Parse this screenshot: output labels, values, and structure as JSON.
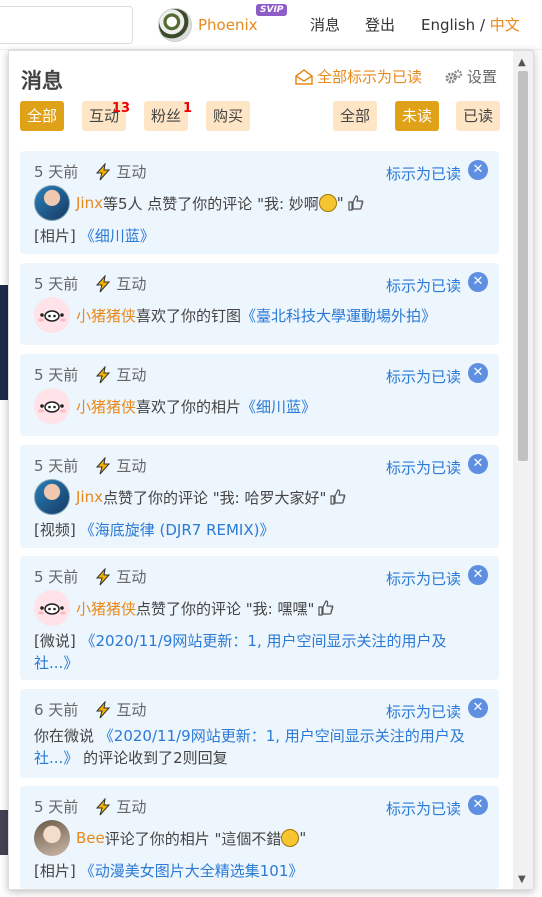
{
  "header": {
    "username": "Phoenix",
    "vip_badge": "SVIP",
    "nav_messages": "消息",
    "nav_login": "登出",
    "lang_en": "English",
    "lang_sep": "/",
    "lang_cn": "中文"
  },
  "popup": {
    "title": "消息",
    "mark_all": "全部标示为已读",
    "settings": "设置",
    "type_tabs": [
      {
        "label": "全部",
        "badge": ""
      },
      {
        "label": "互动",
        "badge": "13"
      },
      {
        "label": "粉丝",
        "badge": "1"
      },
      {
        "label": "购买",
        "badge": ""
      }
    ],
    "read_tabs": [
      {
        "label": "全部"
      },
      {
        "label": "未读"
      },
      {
        "label": "已读"
      }
    ],
    "mark_read_label": "标示为已读",
    "close_glyph": "✕",
    "notifications": [
      {
        "time": "5 天前",
        "type": "互动",
        "user": "Jinx",
        "text": " 等5人 点赞了你的评论 \"我: 妙啊",
        "text_end": "\"",
        "category": "[相片]",
        "link_open": "《",
        "link": "细川蓝",
        "link_close": "》"
      },
      {
        "time": "5 天前",
        "type": "互动",
        "user": "小猪猪侠",
        "text": " 喜欢了你的钉图 ",
        "link_open": "《",
        "link": "臺北科技大學運動場外拍",
        "link_close": "》"
      },
      {
        "time": "5 天前",
        "type": "互动",
        "user": "小猪猪侠",
        "text": " 喜欢了你的相片 ",
        "link_open": "《",
        "link": "细川蓝",
        "link_close": "》"
      },
      {
        "time": "5 天前",
        "type": "互动",
        "user": "Jinx",
        "text": " 点赞了你的评论 \"我: 哈罗大家好\"",
        "category": "[视频]",
        "link_open": "《",
        "link": "海底旋律 (DJR7 REMIX)",
        "link_close": "》"
      },
      {
        "time": "5 天前",
        "type": "互动",
        "user": "小猪猪侠",
        "text": " 点赞了你的评论 \"我: 嘿嘿\"",
        "category": "[微说]",
        "link_open": "《",
        "link": "2020/11/9网站更新：1, 用户空间显示关注的用户及社...",
        "link_close": "》"
      },
      {
        "time": "6 天前",
        "type": "互动",
        "prefix": "你在微说 ",
        "link_open": "《",
        "link": "2020/11/9网站更新：1, 用户空间显示关注的用户及社...",
        "link_close": "》",
        "suffix": " 的评论收到了2则回复"
      },
      {
        "time": "5 天前",
        "type": "互动",
        "user": "Bee",
        "text": " 评论了你的相片 \"這個不錯",
        "text_end": "\"",
        "category": "[相片]",
        "link_open": "《",
        "link": "动漫美女图片大全精选集101",
        "link_close": "》"
      }
    ]
  },
  "colors": {
    "accent": "#e8891c",
    "tab_active": "#dfa118",
    "link": "#2a7ad6",
    "card_bg": "#edf5fd"
  },
  "icons": [
    "envelope-open-icon",
    "gears-icon",
    "lightning-icon",
    "close-circle-icon",
    "thumbs-up-icon",
    "smile-emoji-icon",
    "pig-avatar-icon"
  ]
}
